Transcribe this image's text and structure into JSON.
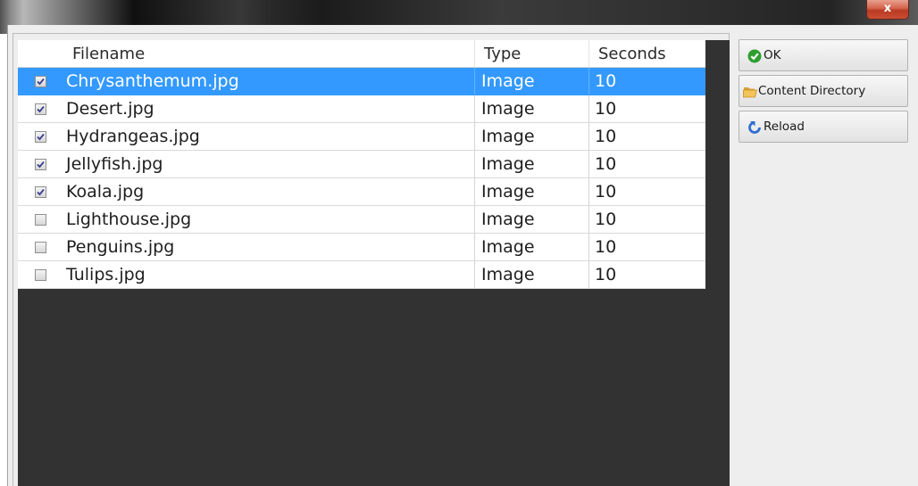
{
  "window": {
    "close_label": "x"
  },
  "table": {
    "columns": [
      "Filename",
      "Type",
      "Seconds"
    ],
    "rows": [
      {
        "checked": true,
        "selected": true,
        "filename": "Chrysanthemum.jpg",
        "type": "Image",
        "seconds": "10"
      },
      {
        "checked": true,
        "selected": false,
        "filename": "Desert.jpg",
        "type": "Image",
        "seconds": "10"
      },
      {
        "checked": true,
        "selected": false,
        "filename": "Hydrangeas.jpg",
        "type": "Image",
        "seconds": "10"
      },
      {
        "checked": true,
        "selected": false,
        "filename": "Jellyfish.jpg",
        "type": "Image",
        "seconds": "10"
      },
      {
        "checked": true,
        "selected": false,
        "filename": "Koala.jpg",
        "type": "Image",
        "seconds": "10"
      },
      {
        "checked": false,
        "selected": false,
        "filename": "Lighthouse.jpg",
        "type": "Image",
        "seconds": "10"
      },
      {
        "checked": false,
        "selected": false,
        "filename": "Penguins.jpg",
        "type": "Image",
        "seconds": "10"
      },
      {
        "checked": false,
        "selected": false,
        "filename": "Tulips.jpg",
        "type": "Image",
        "seconds": "10"
      }
    ]
  },
  "sidebar": {
    "buttons": [
      {
        "label": "OK",
        "icon": "check-circle-icon"
      },
      {
        "label": "Content Directory",
        "icon": "folder-open-icon"
      },
      {
        "label": "Reload",
        "icon": "reload-icon"
      }
    ]
  },
  "colors": {
    "selection": "#3399ff",
    "empty_area": "#323232",
    "ok_icon": "#2f9e2f",
    "folder_icon": "#e8b64a",
    "reload_icon": "#2f6fcf",
    "checkmark": "#3a3f8f"
  }
}
